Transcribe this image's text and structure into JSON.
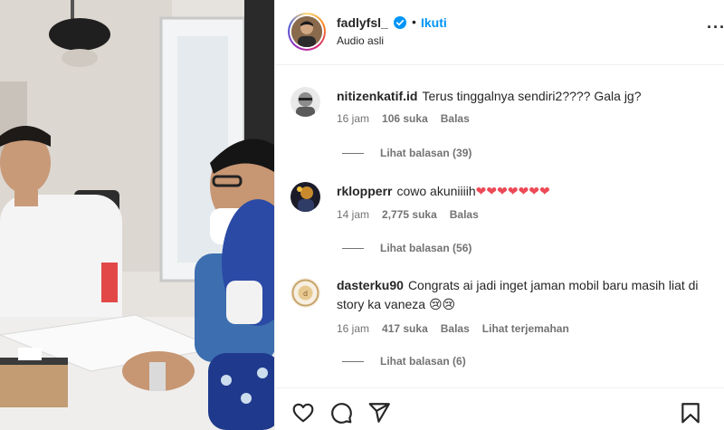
{
  "header": {
    "username": "fadlyfsl_",
    "separator": "•",
    "follow_label": "Ikuti",
    "audio_label": "Audio asli",
    "more_label": "···"
  },
  "comments": [
    {
      "username": "nitizenkatif.id",
      "text": "Terus tinggalnya sendiri2???? Gala jg?",
      "time": "16 jam",
      "likes": "106 suka",
      "reply_label": "Balas",
      "view_replies": "Lihat balasan (39)"
    },
    {
      "username": "rklopperr",
      "text": "cowo akuniiiih",
      "emoji": "❤❤❤❤❤❤❤",
      "time": "14 jam",
      "likes": "2,775 suka",
      "reply_label": "Balas",
      "view_replies": "Lihat balasan (56)"
    },
    {
      "username": "dasterku90",
      "text": "Congrats ai jadi inget jaman mobil baru masih liat di story ka vaneza",
      "emoji": "😢😢",
      "time": "16 jam",
      "likes": "417 suka",
      "reply_label": "Balas",
      "translate_label": "Lihat terjemahan",
      "view_replies": "Lihat balasan (6)"
    }
  ],
  "actions": {
    "like_icon": "heart-icon",
    "comment_icon": "comment-icon",
    "share_icon": "share-icon",
    "save_icon": "bookmark-icon"
  },
  "colors": {
    "link_blue": "#0095f6",
    "secondary_text": "#737373",
    "heart_red": "#ed4956"
  }
}
